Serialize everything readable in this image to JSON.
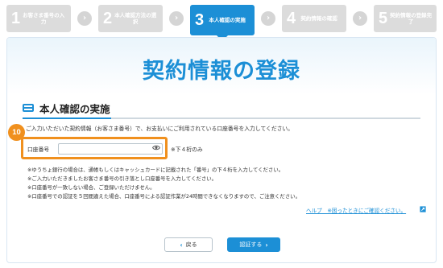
{
  "stepper": {
    "steps": [
      {
        "num": "1",
        "label": "お客さま番号の入力",
        "state": "done"
      },
      {
        "num": "2",
        "label": "本人確認方法の選択",
        "state": "done"
      },
      {
        "num": "3",
        "label": "本人確認の実施",
        "state": "active"
      },
      {
        "num": "4",
        "label": "契約情報の確認",
        "state": "todo"
      },
      {
        "num": "5",
        "label": "契約情報の登録完了",
        "state": "todo"
      }
    ],
    "arrow_glyph": "›"
  },
  "page_title": "契約情報の登録",
  "section_title": "本人確認の実施",
  "intro": "ご入力いただいた契約情報（お客さま番号）で、お支払いにご利用されている口座番号を入力してください。",
  "annotation_number": "10",
  "account_field": {
    "label": "口座番号",
    "value": "",
    "placeholder": "",
    "hint": "※下４桁のみ"
  },
  "notes": [
    "※ゆうちょ銀行の場合は、通帳もしくはキャッシュカードに記載された「番号」の下４桁を入力してください。",
    "※ご入力いただきましたお客さま番号の引き落とし口座番号を入力してください。",
    "※口座番号が一致しない場合、ご登録いただけません。",
    "※口座番号での認証を５回間違えた場合、口座番号による認証作業が24時間できなくなりますので、ご注意ください。"
  ],
  "help_link": "ヘルプ　※困ったときにご確認ください。",
  "buttons": {
    "back_label": "戻る",
    "next_label": "認証する"
  },
  "colors": {
    "accent": "#1c8fd6",
    "annotation": "#f0901e",
    "step_inactive": "#dcdcdc"
  }
}
